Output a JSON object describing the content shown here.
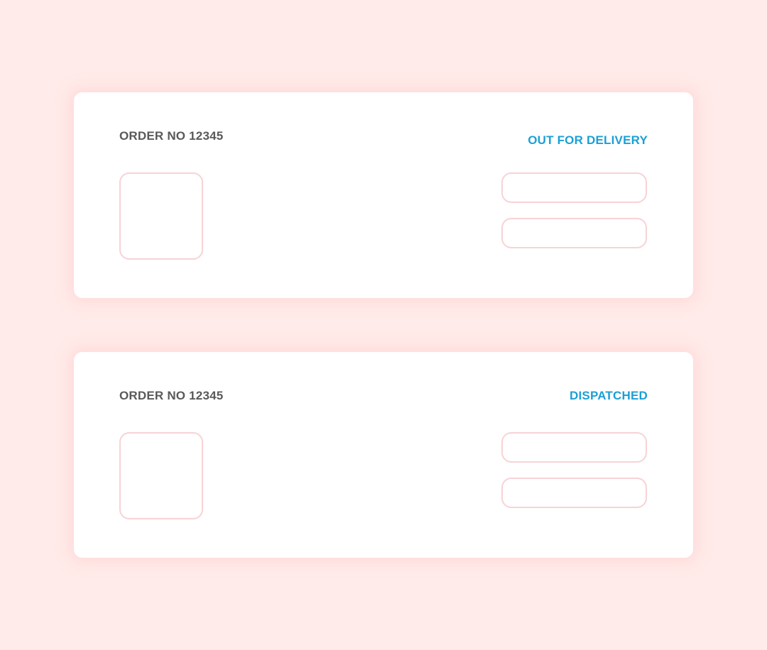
{
  "orders": [
    {
      "order_label": "ORDER NO 12345",
      "status": "OUT FOR DELIVERY"
    },
    {
      "order_label": "ORDER NO 12345",
      "status": "DISPATCHED"
    }
  ],
  "colors": {
    "background": "#ffebe9",
    "card": "#ffffff",
    "order_text": "#595959",
    "status_text": "#1ba0d5",
    "outline": "#f7d3d6"
  }
}
